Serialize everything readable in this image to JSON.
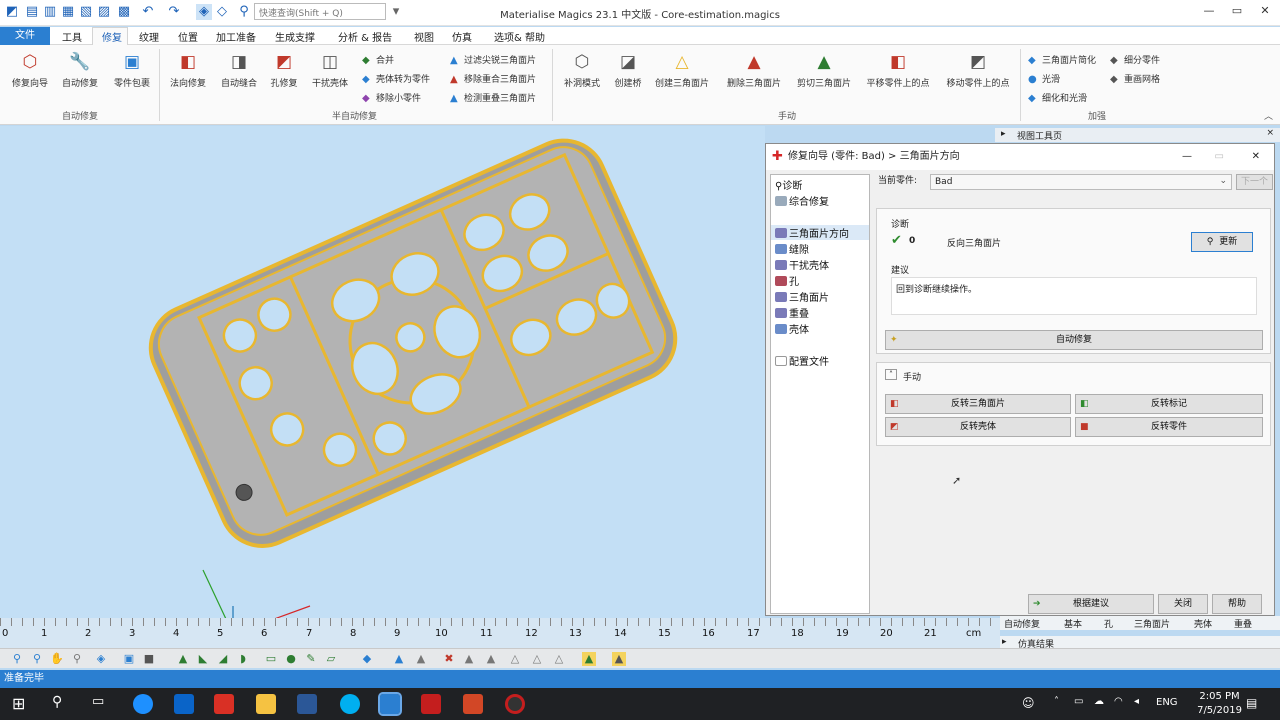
{
  "window": {
    "title": "Materialise Magics 23.1 中文版 - Core-estimation.magics",
    "search_placeholder": "快速查询(Shift + Q)"
  },
  "menus": [
    "工具",
    "修复",
    "纹理",
    "位置",
    "加工准备",
    "生成支撑",
    "分析 & 报告",
    "视图",
    "仿真",
    "选项& 帮助"
  ],
  "file_menu": "文件",
  "ribbon": {
    "auto_group": "自动修复",
    "semi_group": "半自动修复",
    "manual_group": "手动",
    "enhance_group": "加强",
    "big": [
      "修复向导",
      "自动修复",
      "零件包裹",
      "法向修复",
      "自动缝合",
      "孔修复",
      "干扰壳体"
    ],
    "small_a": [
      "合并",
      "壳体转为零件",
      "移除小零件"
    ],
    "small_b": [
      "过滤尖锐三角面片",
      "移除重合三角面片",
      "检测重叠三角面片"
    ],
    "manual": [
      "补洞模式",
      "创建桥",
      "创建三角面片",
      "删除三角面片",
      "剪切三角面片",
      "平移零件上的点",
      "移动零件上的点"
    ],
    "enhance": [
      "三角面片简化",
      "细分零件",
      "光滑",
      "重画网格",
      "细化和光滑"
    ]
  },
  "view_toolbar": "视图工具页",
  "dialog": {
    "title": "修复向导 (零件: Bad) > 三角面片方向",
    "tree_top": [
      "诊断",
      "综合修复"
    ],
    "tree_items": [
      "三角面片方向",
      "缝隙",
      "干扰壳体",
      "孔",
      "三角面片",
      "重叠",
      "壳体"
    ],
    "config": "配置文件",
    "current_part_label": "当前零件:",
    "current_part": "Bad",
    "next": "下一个",
    "diag_title": "诊断",
    "diag_count": "0",
    "diag_text": "反向三角面片",
    "update": "更新",
    "advice_title": "建议",
    "advice_text": "回到诊断继续操作。",
    "auto_fix": "自动修复",
    "manual_title": "手动",
    "flip_tri": "反转三角面片",
    "flip_mark": "反转标记",
    "flip_shell": "反转壳体",
    "flip_part": "反转零件",
    "follow": "根据建议",
    "close": "关闭",
    "help": "帮助"
  },
  "ruler": {
    "ticks": [
      "0",
      "1",
      "2",
      "3",
      "4",
      "5",
      "6",
      "7",
      "8",
      "9",
      "10",
      "11",
      "12",
      "13",
      "14",
      "15",
      "16",
      "17",
      "18",
      "19",
      "20",
      "21"
    ],
    "unit": "cm"
  },
  "bottom_tabs": [
    "自动修复",
    "基本",
    "孔",
    "三角面片",
    "壳体",
    "重叠"
  ],
  "sim_results": "仿真结果",
  "status": "准备完毕",
  "taskbar": {
    "lang": "ENG",
    "time": "2:05 PM",
    "date": "7/5/2019"
  },
  "colors": {
    "accent": "#2b7fd1",
    "mesh": "#e8b730",
    "part": "#a9a9a9"
  }
}
